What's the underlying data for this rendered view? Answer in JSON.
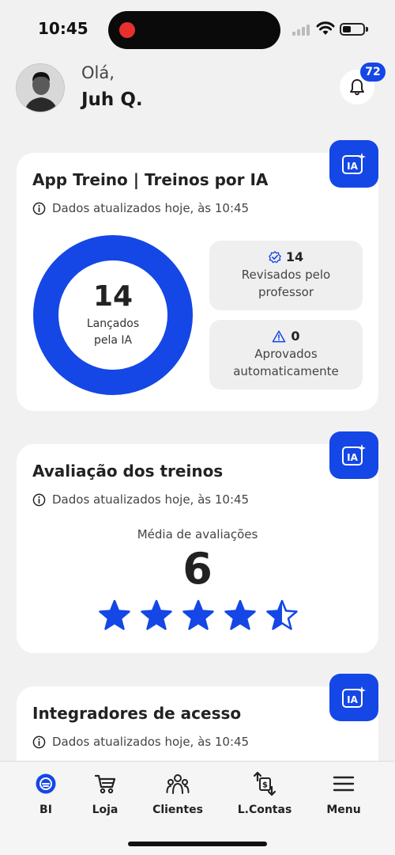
{
  "status_bar": {
    "time": "10:45"
  },
  "header": {
    "greeting": "Olá,",
    "user_name": "Juh Q.",
    "notification_count": "72"
  },
  "cards": [
    {
      "title": "App Treino | Treinos por IA",
      "updated": "Dados atualizados hoje, às 10:45",
      "ia_icon": "IA",
      "donut": {
        "value": "14",
        "label": "Lançados pela IA",
        "fill_fraction": 1.0
      },
      "stats": [
        {
          "icon": "check-badge-icon",
          "value": "14",
          "label": "Revisados pelo professor"
        },
        {
          "icon": "warning-icon",
          "value": "0",
          "label": "Aprovados automaticamente"
        }
      ]
    },
    {
      "title": "Avaliação dos treinos",
      "updated": "Dados atualizados hoje, às 10:45",
      "ia_icon": "IA",
      "avg_label": "Média de avaliações",
      "avg_value": "6",
      "stars_rating": 4.5,
      "stars_max": 5
    },
    {
      "title": "Integradores de acesso",
      "updated": "Dados atualizados hoje, às 10:45",
      "ia_icon": "IA"
    }
  ],
  "nav": [
    {
      "label": "BI",
      "icon": "bi-icon",
      "active": true
    },
    {
      "label": "Loja",
      "icon": "cart-icon"
    },
    {
      "label": "Clientes",
      "icon": "people-icon"
    },
    {
      "label": "L.Contas",
      "icon": "accounts-icon"
    },
    {
      "label": "Menu",
      "icon": "menu-icon"
    }
  ],
  "colors": {
    "accent": "#1447e6",
    "background": "#f1f1f1",
    "card": "#ffffff"
  }
}
